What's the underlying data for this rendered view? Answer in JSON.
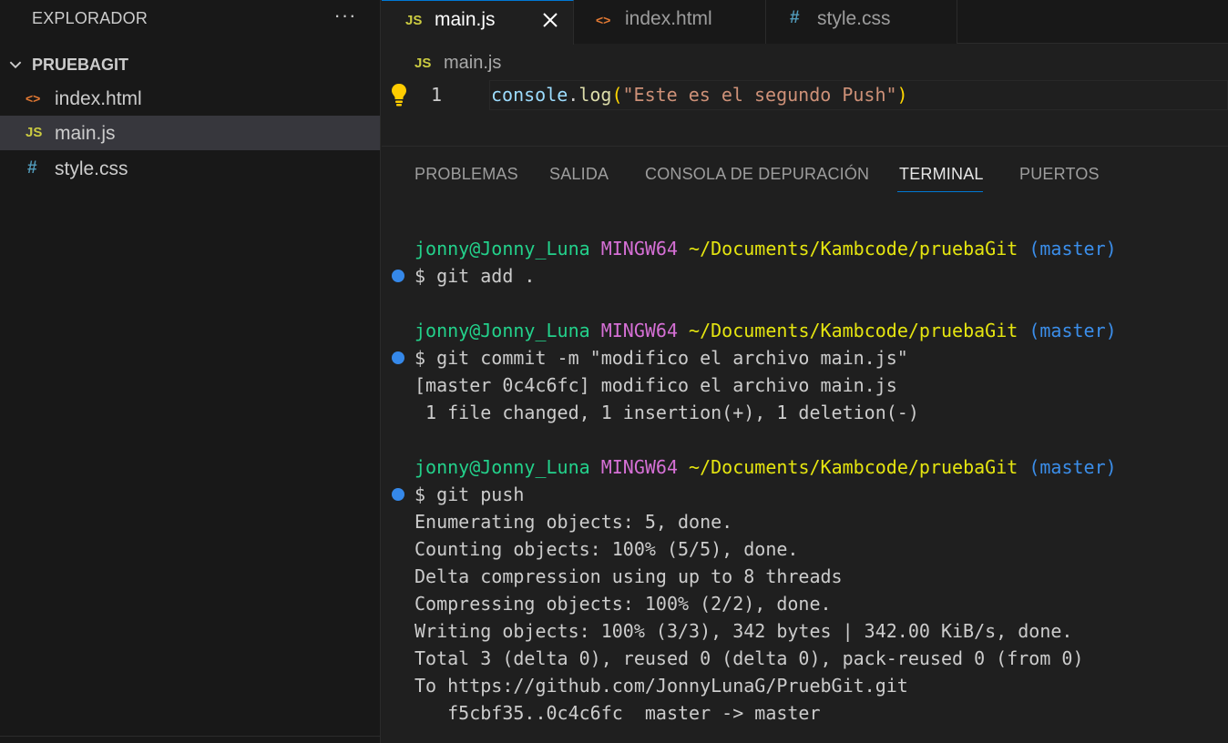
{
  "sidebar": {
    "title": "EXPLORADOR",
    "more_label": "···",
    "folder": "PRUEBAGIT",
    "files": [
      {
        "icon": "<>",
        "icon_color": "#e37933",
        "label": "index.html"
      },
      {
        "icon": "JS",
        "icon_color": "#cbcb41",
        "label": "main.js"
      },
      {
        "icon": "#",
        "icon_color": "#519aba",
        "label": "style.css"
      }
    ]
  },
  "tabs": [
    {
      "icon": "JS",
      "icon_color": "#cbcb41",
      "label": "main.js"
    },
    {
      "icon": "<>",
      "icon_color": "#e37933",
      "label": "index.html"
    },
    {
      "icon": "#",
      "icon_color": "#519aba",
      "label": "style.css"
    }
  ],
  "breadcrumb": {
    "icon": "JS",
    "label": "main.js"
  },
  "editor": {
    "line_number": "1",
    "code": {
      "obj": "console",
      "dot": ".",
      "fn": "log",
      "open": "(",
      "str": "\"Este es el segundo Push\"",
      "close": ")"
    }
  },
  "panel_tabs": [
    "PROBLEMAS",
    "SALIDA",
    "CONSOLA DE DEPURACIÓN",
    "TERMINAL",
    "PUERTOS"
  ],
  "terminal": {
    "prompt": {
      "user": "jonny@Jonny_Luna",
      "ming": "MINGW64",
      "path": "~/Documents/Kambcode/pruebaGit",
      "branch": "(master)"
    },
    "cmd1": "$ git add .",
    "cmd2": "$ git commit -m \"modifico el archivo main.js\"",
    "out2": [
      "[master 0c4c6fc] modifico el archivo main.js",
      " 1 file changed, 1 insertion(+), 1 deletion(-)"
    ],
    "cmd3": "$ git push",
    "out3": [
      "Enumerating objects: 5, done.",
      "Counting objects: 100% (5/5), done.",
      "Delta compression using up to 8 threads",
      "Compressing objects: 100% (2/2), done.",
      "Writing objects: 100% (3/3), 342 bytes | 342.00 KiB/s, done.",
      "Total 3 (delta 0), reused 0 (delta 0), pack-reused 0 (from 0)",
      "To https://github.com/JonnyLunaG/PruebGit.git",
      "   f5cbf35..0c4c6fc  master -> master"
    ]
  },
  "colors": {
    "accent": "#0078d4",
    "js_icon": "#cbcb41",
    "html_icon": "#e37933",
    "css_icon": "#519aba"
  }
}
